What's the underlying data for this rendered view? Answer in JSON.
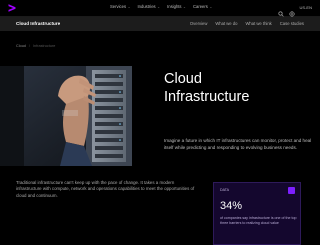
{
  "header": {
    "logo_name": "accenture-chevron-logo",
    "brand_color": "#A100FF",
    "nav_items": [
      {
        "label": "Services"
      },
      {
        "label": "Industries"
      },
      {
        "label": "Insights"
      },
      {
        "label": "Careers"
      }
    ],
    "locale_label": "US-EN"
  },
  "subheader": {
    "title": "Cloud Infrastructure",
    "links": [
      "Overview",
      "What we do",
      "What we think",
      "Case studies"
    ]
  },
  "breadcrumb": [
    "Cloud",
    "Infrastructure"
  ],
  "hero": {
    "title_line1": "Cloud",
    "title_line2": "Infrastructure",
    "description": "Imagine a future in which IT infrastructures can monitor, protect and heal itself while predicting and responding to evolving business needs."
  },
  "intro": {
    "text": "Traditional infrastructure can't keep up with the pace of change. It takes a modern infrastructure with compute, network and operations capabilities to meet the opportunities of cloud and continuum."
  },
  "stat": {
    "tag": "DATA",
    "value": "34%",
    "text": "of companies say infrastructure is one of the top three barriers to realizing cloud value",
    "accent_color": "#7D1FFF"
  }
}
